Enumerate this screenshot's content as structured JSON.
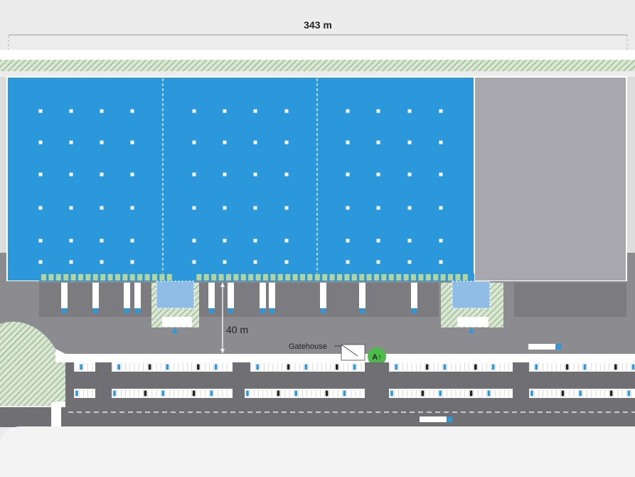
{
  "labels": {
    "width_dimension": "343 m",
    "yard_depth": "40 m",
    "gatehouse": "Gatehouse",
    "access_badge": "A↑"
  },
  "colors": {
    "background": "#ececec",
    "warehouse_blue": "#2b98dc",
    "warehouse_grey": "#a7a7ad",
    "yard_grey": "#8c8c90",
    "dock_grey": "#7b7b80",
    "road_grey": "#6f6f74",
    "green_hatch": "#a8c79f",
    "gatehouse_green": "#4cbb4a"
  },
  "icons": {
    "vehicle": "car-icon",
    "entrance": "triangle-marker-icon",
    "dimension": "dimension-arrow-icon"
  }
}
